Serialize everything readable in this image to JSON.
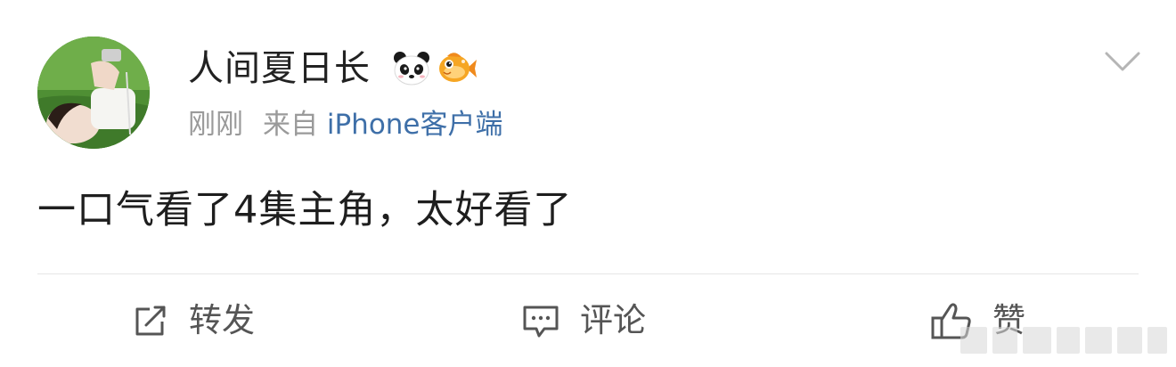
{
  "post": {
    "author": "人间夏日长",
    "time": "刚刚",
    "source_prefix": "来自",
    "source": "iPhone客户端",
    "text": "一口气看了4集主角，太好看了",
    "badges": [
      "panda-icon",
      "goldfish-icon"
    ]
  },
  "actions": {
    "repost_label": "转发",
    "comment_label": "评论",
    "like_label": "赞"
  },
  "colors": {
    "link": "#3e6fa8",
    "meta": "#9a9a9a",
    "text": "#1e1e1e",
    "action_text": "#555555",
    "divider": "#e6e6e6"
  }
}
